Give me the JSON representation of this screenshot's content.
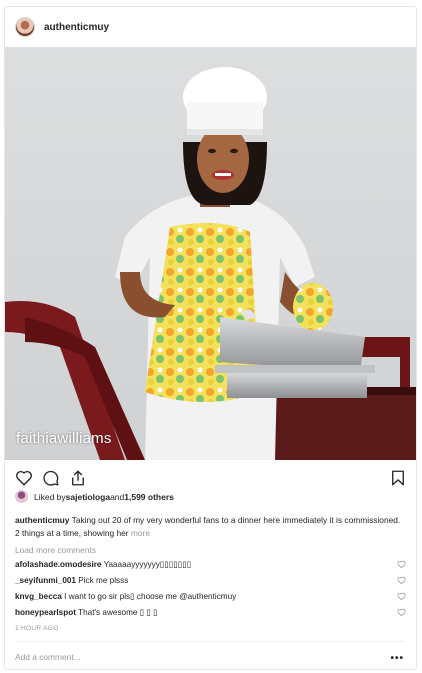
{
  "post": {
    "username": "authenticmuy",
    "watermark": "faithiawilliams",
    "avatar_icon": "profile-avatar",
    "photo_alt": "chef-photo"
  },
  "actions": {
    "like_icon": "heart-icon",
    "comment_icon": "comment-icon",
    "share_icon": "share-icon",
    "save_icon": "bookmark-icon"
  },
  "likes": {
    "prefix": "Liked by ",
    "user": "sajetiologa",
    "middle": " and ",
    "count": "1,599 others"
  },
  "caption": {
    "username": "authenticmuy",
    "text": " Taking out 20 of my very wonderful fans to a dinner here immediately it is commissioned. 2 things at a time, showing her ",
    "more": "more"
  },
  "load_more": "Load more comments",
  "comments": [
    {
      "user": "afolashade.omodesire",
      "text": "Yaaaaayyyyyyy▯▯▯▯▯▯▯"
    },
    {
      "user": "_seyifunmi_001",
      "text": "Pick me plsss"
    },
    {
      "user": "knvg_becca",
      "text": "I want to go sir pls▯ choose me @authenticmuy"
    },
    {
      "user": "honeypearlspot",
      "text": "That's awesome ▯ ▯ ▯"
    }
  ],
  "timestamp": "1 HOUR AGO",
  "add_comment_placeholder": "Add a comment...",
  "more_options": "•••",
  "colors": {
    "text": "#262626",
    "muted": "#999999",
    "border": "#e6e6e6"
  }
}
